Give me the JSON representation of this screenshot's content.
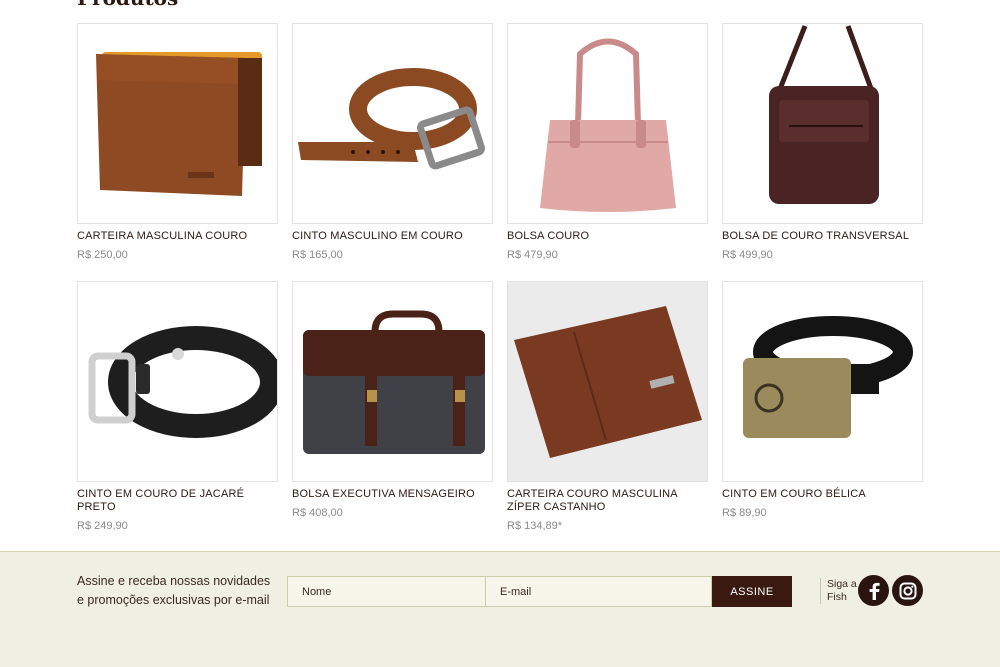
{
  "section": {
    "title": "Produtos"
  },
  "products": [
    {
      "name": "CARTEIRA MASCULINA COURO",
      "price": "R$ 250,00",
      "image": "brown-bifold-wallet"
    },
    {
      "name": "CINTO MASCULINO EM COURO",
      "price": "R$ 165,00",
      "image": "brown-leather-belt"
    },
    {
      "name": "BOLSA COURO",
      "price": "R$ 479,90",
      "image": "pink-handbag"
    },
    {
      "name": "BOLSA DE COURO TRANSVERSAL",
      "price": "R$ 499,90",
      "image": "dark-crossbody-bag"
    },
    {
      "name": "CINTO EM COURO DE JACARÉ PRETO",
      "price": "R$ 249,90",
      "image": "black-crocodile-belt"
    },
    {
      "name": "BOLSA EXECUTIVA MENSAGEIRO",
      "price": "R$ 408,00",
      "image": "gray-messenger-bag"
    },
    {
      "name": "CARTEIRA COURO MASCULINA ZÍPER CASTANHO",
      "price": "R$ 134,89*",
      "image": "brown-zip-wallet"
    },
    {
      "name": "CINTO EM COURO BÉLICA",
      "price": "R$ 89,90",
      "image": "black-belt-bronze-buckle"
    }
  ],
  "newsletter": {
    "text": "Assine e receba nossas novidades e promoções exclusivas por e-mail",
    "name_placeholder": "Nome",
    "email_placeholder": "E-mail",
    "button_label": "ASSINE"
  },
  "social": {
    "label": "Siga a Fish",
    "icons": [
      "facebook-icon",
      "instagram-icon"
    ]
  },
  "colors": {
    "brand_dark": "#3a1a10",
    "newsletter_bg": "#f0efe3",
    "price_gray": "#8a8a8a"
  }
}
